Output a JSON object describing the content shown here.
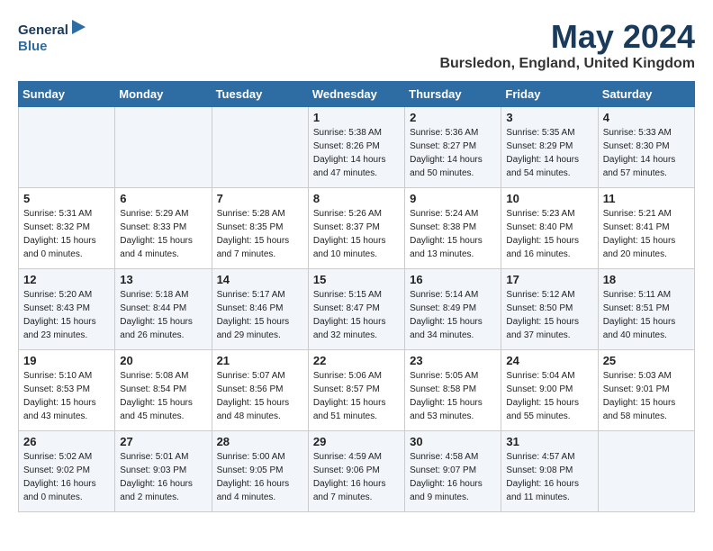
{
  "logo": {
    "line1": "General",
    "line2": "Blue"
  },
  "title": "May 2024",
  "location": "Bursledon, England, United Kingdom",
  "weekdays": [
    "Sunday",
    "Monday",
    "Tuesday",
    "Wednesday",
    "Thursday",
    "Friday",
    "Saturday"
  ],
  "weeks": [
    [
      {
        "day": "",
        "info": ""
      },
      {
        "day": "",
        "info": ""
      },
      {
        "day": "",
        "info": ""
      },
      {
        "day": "1",
        "info": "Sunrise: 5:38 AM\nSunset: 8:26 PM\nDaylight: 14 hours\nand 47 minutes."
      },
      {
        "day": "2",
        "info": "Sunrise: 5:36 AM\nSunset: 8:27 PM\nDaylight: 14 hours\nand 50 minutes."
      },
      {
        "day": "3",
        "info": "Sunrise: 5:35 AM\nSunset: 8:29 PM\nDaylight: 14 hours\nand 54 minutes."
      },
      {
        "day": "4",
        "info": "Sunrise: 5:33 AM\nSunset: 8:30 PM\nDaylight: 14 hours\nand 57 minutes."
      }
    ],
    [
      {
        "day": "5",
        "info": "Sunrise: 5:31 AM\nSunset: 8:32 PM\nDaylight: 15 hours\nand 0 minutes."
      },
      {
        "day": "6",
        "info": "Sunrise: 5:29 AM\nSunset: 8:33 PM\nDaylight: 15 hours\nand 4 minutes."
      },
      {
        "day": "7",
        "info": "Sunrise: 5:28 AM\nSunset: 8:35 PM\nDaylight: 15 hours\nand 7 minutes."
      },
      {
        "day": "8",
        "info": "Sunrise: 5:26 AM\nSunset: 8:37 PM\nDaylight: 15 hours\nand 10 minutes."
      },
      {
        "day": "9",
        "info": "Sunrise: 5:24 AM\nSunset: 8:38 PM\nDaylight: 15 hours\nand 13 minutes."
      },
      {
        "day": "10",
        "info": "Sunrise: 5:23 AM\nSunset: 8:40 PM\nDaylight: 15 hours\nand 16 minutes."
      },
      {
        "day": "11",
        "info": "Sunrise: 5:21 AM\nSunset: 8:41 PM\nDaylight: 15 hours\nand 20 minutes."
      }
    ],
    [
      {
        "day": "12",
        "info": "Sunrise: 5:20 AM\nSunset: 8:43 PM\nDaylight: 15 hours\nand 23 minutes."
      },
      {
        "day": "13",
        "info": "Sunrise: 5:18 AM\nSunset: 8:44 PM\nDaylight: 15 hours\nand 26 minutes."
      },
      {
        "day": "14",
        "info": "Sunrise: 5:17 AM\nSunset: 8:46 PM\nDaylight: 15 hours\nand 29 minutes."
      },
      {
        "day": "15",
        "info": "Sunrise: 5:15 AM\nSunset: 8:47 PM\nDaylight: 15 hours\nand 32 minutes."
      },
      {
        "day": "16",
        "info": "Sunrise: 5:14 AM\nSunset: 8:49 PM\nDaylight: 15 hours\nand 34 minutes."
      },
      {
        "day": "17",
        "info": "Sunrise: 5:12 AM\nSunset: 8:50 PM\nDaylight: 15 hours\nand 37 minutes."
      },
      {
        "day": "18",
        "info": "Sunrise: 5:11 AM\nSunset: 8:51 PM\nDaylight: 15 hours\nand 40 minutes."
      }
    ],
    [
      {
        "day": "19",
        "info": "Sunrise: 5:10 AM\nSunset: 8:53 PM\nDaylight: 15 hours\nand 43 minutes."
      },
      {
        "day": "20",
        "info": "Sunrise: 5:08 AM\nSunset: 8:54 PM\nDaylight: 15 hours\nand 45 minutes."
      },
      {
        "day": "21",
        "info": "Sunrise: 5:07 AM\nSunset: 8:56 PM\nDaylight: 15 hours\nand 48 minutes."
      },
      {
        "day": "22",
        "info": "Sunrise: 5:06 AM\nSunset: 8:57 PM\nDaylight: 15 hours\nand 51 minutes."
      },
      {
        "day": "23",
        "info": "Sunrise: 5:05 AM\nSunset: 8:58 PM\nDaylight: 15 hours\nand 53 minutes."
      },
      {
        "day": "24",
        "info": "Sunrise: 5:04 AM\nSunset: 9:00 PM\nDaylight: 15 hours\nand 55 minutes."
      },
      {
        "day": "25",
        "info": "Sunrise: 5:03 AM\nSunset: 9:01 PM\nDaylight: 15 hours\nand 58 minutes."
      }
    ],
    [
      {
        "day": "26",
        "info": "Sunrise: 5:02 AM\nSunset: 9:02 PM\nDaylight: 16 hours\nand 0 minutes."
      },
      {
        "day": "27",
        "info": "Sunrise: 5:01 AM\nSunset: 9:03 PM\nDaylight: 16 hours\nand 2 minutes."
      },
      {
        "day": "28",
        "info": "Sunrise: 5:00 AM\nSunset: 9:05 PM\nDaylight: 16 hours\nand 4 minutes."
      },
      {
        "day": "29",
        "info": "Sunrise: 4:59 AM\nSunset: 9:06 PM\nDaylight: 16 hours\nand 7 minutes."
      },
      {
        "day": "30",
        "info": "Sunrise: 4:58 AM\nSunset: 9:07 PM\nDaylight: 16 hours\nand 9 minutes."
      },
      {
        "day": "31",
        "info": "Sunrise: 4:57 AM\nSunset: 9:08 PM\nDaylight: 16 hours\nand 11 minutes."
      },
      {
        "day": "",
        "info": ""
      }
    ]
  ]
}
